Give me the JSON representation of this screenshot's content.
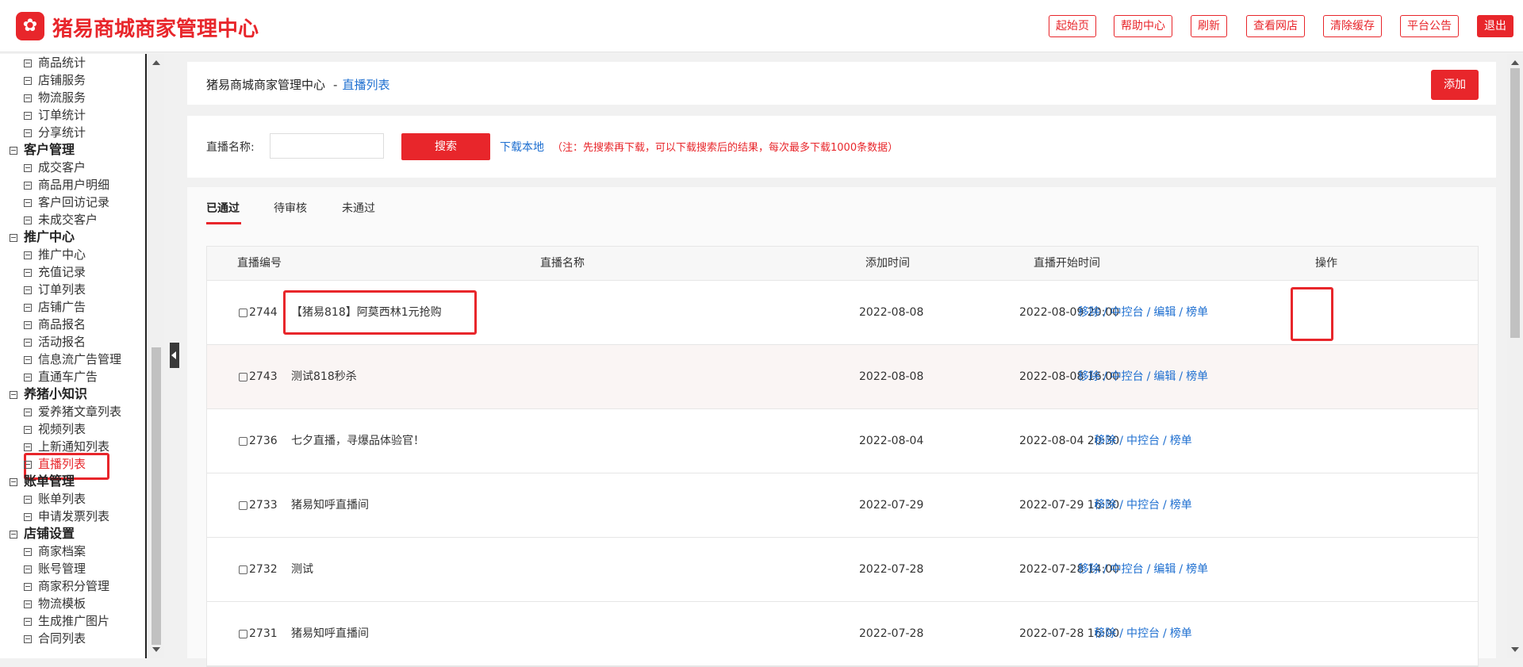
{
  "app": {
    "title": "猪易商城商家管理中心"
  },
  "topbar": {
    "buttons": [
      {
        "label": "起始页"
      },
      {
        "label": "帮助中心"
      },
      {
        "label": "刷新"
      },
      {
        "label": "查看网店"
      },
      {
        "label": "清除缓存"
      },
      {
        "label": "平台公告"
      },
      {
        "label": "退出"
      }
    ]
  },
  "sidebar": {
    "nav": [
      {
        "type": "item",
        "label": "商品统计"
      },
      {
        "type": "item",
        "label": "店铺服务"
      },
      {
        "type": "item",
        "label": "物流服务"
      },
      {
        "type": "item",
        "label": "订单统计"
      },
      {
        "type": "item",
        "label": "分享统计"
      },
      {
        "type": "group",
        "label": "客户管理"
      },
      {
        "type": "item",
        "label": "成交客户"
      },
      {
        "type": "item",
        "label": "商品用户明细"
      },
      {
        "type": "item",
        "label": "客户回访记录"
      },
      {
        "type": "item",
        "label": "未成交客户"
      },
      {
        "type": "group",
        "label": "推广中心"
      },
      {
        "type": "item",
        "label": "推广中心"
      },
      {
        "type": "item",
        "label": "充值记录"
      },
      {
        "type": "item",
        "label": "订单列表"
      },
      {
        "type": "item",
        "label": "店铺广告"
      },
      {
        "type": "item",
        "label": "商品报名"
      },
      {
        "type": "item",
        "label": "活动报名"
      },
      {
        "type": "item",
        "label": "信息流广告管理"
      },
      {
        "type": "item",
        "label": "直通车广告"
      },
      {
        "type": "group",
        "label": "养猪小知识"
      },
      {
        "type": "item",
        "label": "爱养猪文章列表"
      },
      {
        "type": "item",
        "label": "视频列表"
      },
      {
        "type": "item",
        "label": "上新通知列表"
      },
      {
        "type": "item",
        "label": "直播列表",
        "active": true
      },
      {
        "type": "group",
        "label": "账单管理"
      },
      {
        "type": "item",
        "label": "账单列表"
      },
      {
        "type": "item",
        "label": "申请发票列表"
      },
      {
        "type": "group",
        "label": "店铺设置"
      },
      {
        "type": "item",
        "label": "商家档案"
      },
      {
        "type": "item",
        "label": "账号管理"
      },
      {
        "type": "item",
        "label": "商家积分管理"
      },
      {
        "type": "item",
        "label": "物流模板"
      },
      {
        "type": "item",
        "label": "生成推广图片"
      },
      {
        "type": "item",
        "label": "合同列表"
      }
    ]
  },
  "breadcrumb": {
    "root": "猪易商城商家管理中心",
    "separator": "-",
    "current": "直播列表"
  },
  "add_label": "添加",
  "search": {
    "label": "直播名称:",
    "placeholder": "",
    "button": "搜索",
    "download": "下载本地",
    "note": "（注：先搜索再下载，可以下载搜索后的结果，每次最多下载1000条数据）"
  },
  "tabs": [
    {
      "label": "已通过",
      "active": true
    },
    {
      "label": "待审核"
    },
    {
      "label": "未通过"
    }
  ],
  "table": {
    "headers": [
      "直播编号",
      "直播名称",
      "添加时间",
      "直播开始时间",
      "操作"
    ],
    "rows": [
      {
        "id": "2744",
        "name": "【猪易818】阿莫西林1元抢购",
        "added": "2022-08-08",
        "start": "2022-08-09 20:00",
        "ops": [
          "移除",
          "中控台",
          "编辑",
          "榜单"
        ]
      },
      {
        "id": "2743",
        "name": "测试818秒杀",
        "added": "2022-08-08",
        "start": "2022-08-08 16:00",
        "ops": [
          "移除",
          "中控台",
          "编辑",
          "榜单"
        ]
      },
      {
        "id": "2736",
        "name": "七夕直播，寻爆品体验官！",
        "added": "2022-08-04",
        "start": "2022-08-04 20:30",
        "ops": [
          "移除",
          "中控台",
          "榜单"
        ]
      },
      {
        "id": "2733",
        "name": "猪易知呼直播间",
        "added": "2022-07-29",
        "start": "2022-07-29 16:30",
        "ops": [
          "移除",
          "中控台",
          "榜单"
        ]
      },
      {
        "id": "2732",
        "name": "测试",
        "added": "2022-07-28",
        "start": "2022-07-28 14:00",
        "ops": [
          "移除",
          "中控台",
          "编辑",
          "榜单"
        ]
      },
      {
        "id": "2731",
        "name": "猪易知呼直播间",
        "added": "2022-07-28",
        "start": "2022-07-28 16:00",
        "ops": [
          "移除",
          "中控台",
          "榜单"
        ]
      }
    ]
  },
  "colors": {
    "accent": "#e8262b",
    "link": "#1e6fd0"
  }
}
